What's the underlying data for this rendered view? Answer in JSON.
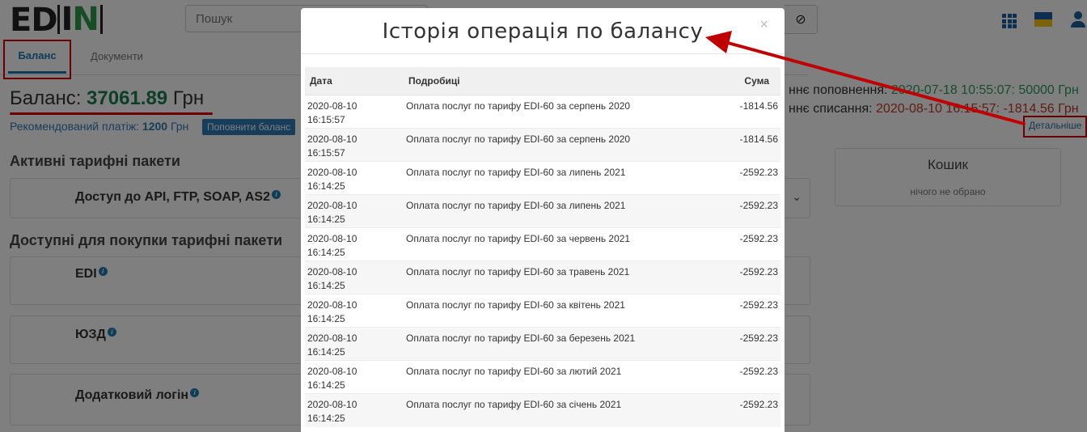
{
  "header": {
    "logo_text": "EDIN",
    "search_placeholder": "Пошук",
    "search_button_icon": "ban-icon",
    "apps_icon": "grid-icon",
    "language_icon": "ukraine-flag-icon",
    "user_icon": "user-icon"
  },
  "tabs": [
    {
      "label": "Баланс",
      "active": true
    },
    {
      "label": "Документи",
      "active": false
    }
  ],
  "balance": {
    "label": "Баланс:",
    "value": "37061.89",
    "currency": "Грн",
    "recommended_label": "Рекомендований платіж:",
    "recommended_value": "1200",
    "recommended_currency": "Грн",
    "topup_button": "Поповнити баланс"
  },
  "right_panel": {
    "last_topup_label": "ннє поповнення:",
    "last_topup_value": "2020-07-18 10:55:07: 50000 Грн",
    "last_charge_label": "ннє списання:",
    "last_charge_value": "2020-08-10 16:15:57: -1814.56 Грн",
    "details_link": "Детальніше"
  },
  "sections": {
    "active_title": "Активні тарифні пакети",
    "available_title": "Доступні для покупки тарифні пакети",
    "active_packages": [
      "Доступ до API, FTP, SOAP, AS2"
    ],
    "available_packages": [
      "EDI",
      "ЮЗД",
      "Додатковий логін"
    ]
  },
  "cart": {
    "title": "Кошик",
    "empty_text": "нічого не обрано"
  },
  "modal": {
    "title": "Історія операція по балансу",
    "close": "×",
    "columns": [
      "Дата",
      "Подробиці",
      "Сума"
    ],
    "rows": [
      {
        "date": "2020-08-10",
        "time": "16:15:57",
        "desc": "Оплата послуг по тарифу EDI-60 за серпень 2020",
        "sum": "-1814.56"
      },
      {
        "date": "2020-08-10",
        "time": "16:15:57",
        "desc": "Оплата послуг по тарифу EDI-60 за серпень 2020",
        "sum": "-1814.56"
      },
      {
        "date": "2020-08-10",
        "time": "16:14:25",
        "desc": "Оплата послуг по тарифу EDI-60 за липень 2021",
        "sum": "-2592.23"
      },
      {
        "date": "2020-08-10",
        "time": "16:14:25",
        "desc": "Оплата послуг по тарифу EDI-60 за липень 2021",
        "sum": "-2592.23"
      },
      {
        "date": "2020-08-10",
        "time": "16:14:25",
        "desc": "Оплата послуг по тарифу EDI-60 за червень 2021",
        "sum": "-2592.23"
      },
      {
        "date": "2020-08-10",
        "time": "16:14:25",
        "desc": "Оплата послуг по тарифу EDI-60 за травень 2021",
        "sum": "-2592.23"
      },
      {
        "date": "2020-08-10",
        "time": "16:14:25",
        "desc": "Оплата послуг по тарифу EDI-60 за квітень 2021",
        "sum": "-2592.23"
      },
      {
        "date": "2020-08-10",
        "time": "16:14:25",
        "desc": "Оплата послуг по тарифу EDI-60 за березень 2021",
        "sum": "-2592.23"
      },
      {
        "date": "2020-08-10",
        "time": "16:14:25",
        "desc": "Оплата послуг по тарифу EDI-60 за лютий 2021",
        "sum": "-2592.23"
      },
      {
        "date": "2020-08-10",
        "time": "16:14:25",
        "desc": "Оплата послуг по тарифу EDI-60 за січень 2021",
        "sum": "-2592.23"
      }
    ]
  },
  "colors": {
    "accent": "#1a7ab0",
    "balance_green": "#1b7d55",
    "annotation_red": "#d40000"
  }
}
